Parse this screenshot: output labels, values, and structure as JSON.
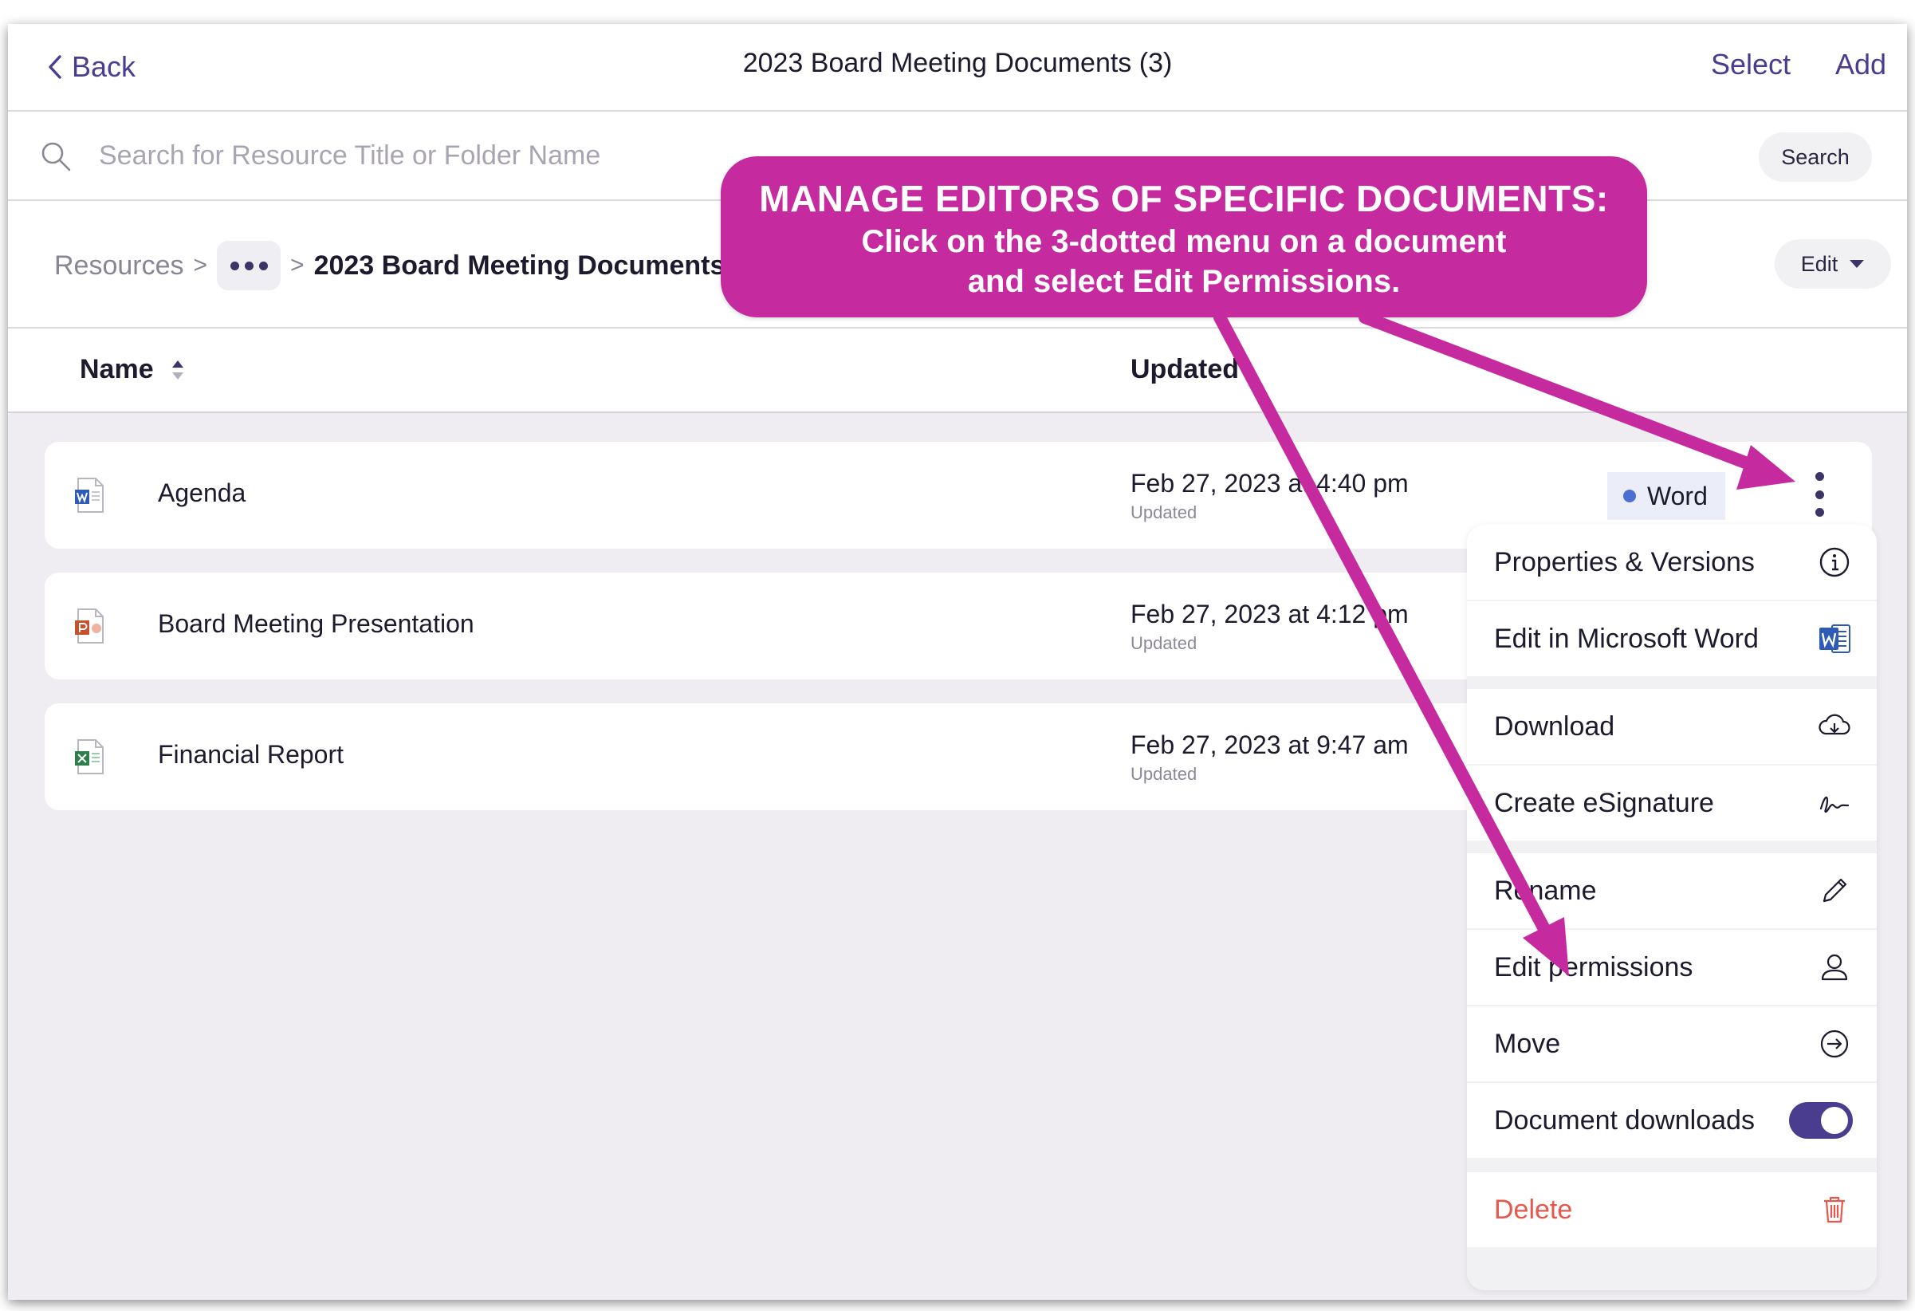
{
  "nav": {
    "back_label": "Back",
    "title": "2023 Board Meeting Documents (3)",
    "select_label": "Select",
    "add_label": "Add"
  },
  "search": {
    "placeholder": "Search for Resource Title or Folder Name",
    "button_label": "Search"
  },
  "breadcrumb": {
    "root": "Resources",
    "separator": ">",
    "current": "2023 Board Meeting Documents",
    "edit_label": "Edit"
  },
  "columns": {
    "name": "Name",
    "updated": "Updated"
  },
  "rows": [
    {
      "name": "Agenda",
      "date": "Feb 27, 2023 at 4:40 pm",
      "sub": "Updated",
      "type": "Word",
      "icon": "word-file-icon"
    },
    {
      "name": "Board Meeting Presentation",
      "date": "Feb 27, 2023 at 4:12 pm",
      "sub": "Updated",
      "icon": "powerpoint-file-icon"
    },
    {
      "name": "Financial Report",
      "date": "Feb 27, 2023 at 9:47 am",
      "sub": "Updated",
      "icon": "excel-file-icon"
    }
  ],
  "menu": {
    "items": [
      {
        "label": "Properties & Versions",
        "icon": "info-icon"
      },
      {
        "label": "Edit in Microsoft Word",
        "icon": "word-icon"
      },
      {
        "label": "Download",
        "icon": "cloud-download-icon"
      },
      {
        "label": "Create eSignature",
        "icon": "signature-icon"
      },
      {
        "label": "Rename",
        "icon": "pencil-icon"
      },
      {
        "label": "Edit permissions",
        "icon": "person-icon"
      },
      {
        "label": "Move",
        "icon": "arrow-circle-icon"
      },
      {
        "label": "Document downloads",
        "icon": "toggle",
        "toggle_on": true
      },
      {
        "label": "Delete",
        "icon": "trash-icon"
      }
    ]
  },
  "callout": {
    "title": "MANAGE EDITORS OF SPECIFIC DOCUMENTS:",
    "line1": "Click on the 3-dotted menu on a document",
    "line2": "and select Edit Permissions."
  },
  "colors": {
    "accent": "#4a3d8f",
    "callout": "#c52a9f",
    "danger": "#e5584b",
    "word_badge": "#4a6fd0"
  }
}
